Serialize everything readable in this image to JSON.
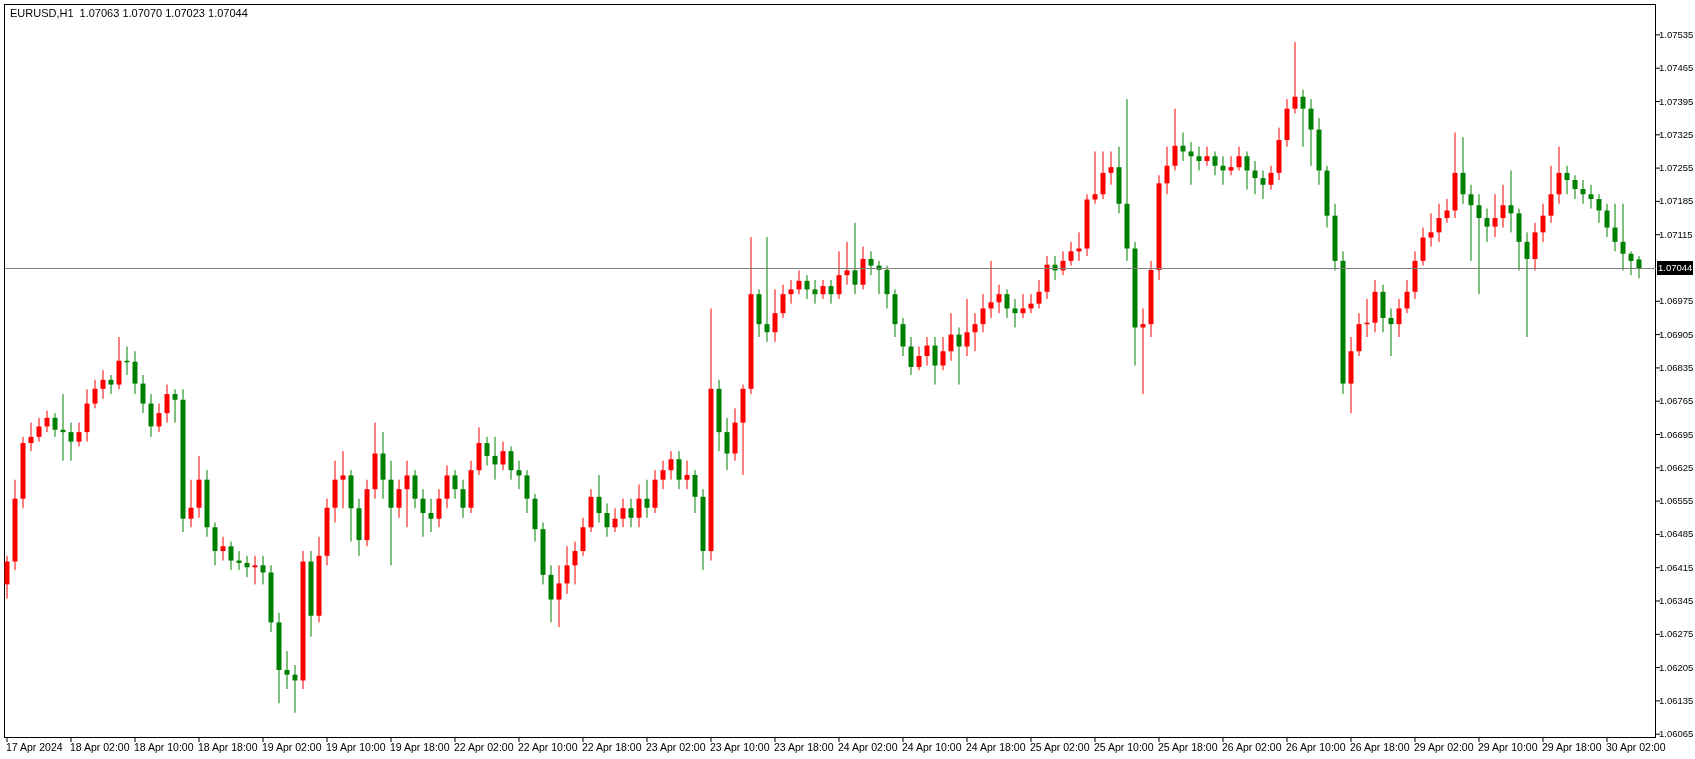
{
  "chart_header": {
    "symbol": "EURUSD,H1",
    "quotes": [
      "1.07063",
      "1.07070",
      "1.07023",
      "1.07044"
    ]
  },
  "price_axis": {
    "current_price": "1.07044"
  },
  "time_axis": {
    "labels": [
      "17 Apr 2024",
      "18 Apr 02:00",
      "18 Apr 10:00",
      "18 Apr 18:00",
      "19 Apr 02:00",
      "19 Apr 10:00",
      "19 Apr 18:00",
      "22 Apr 02:00",
      "22 Apr 10:00",
      "22 Apr 18:00",
      "23 Apr 02:00",
      "23 Apr 10:00",
      "23 Apr 18:00",
      "24 Apr 02:00",
      "24 Apr 10:00",
      "24 Apr 18:00",
      "25 Apr 02:00",
      "25 Apr 10:00",
      "25 Apr 18:00",
      "26 Apr 02:00",
      "26 Apr 10:00",
      "26 Apr 18:00",
      "29 Apr 02:00",
      "29 Apr 10:00",
      "29 Apr 18:00",
      "30 Apr 02:00"
    ]
  },
  "chart": {
    "chart_data": {
      "type": "candlestick",
      "ylim": [
        1.06057,
        1.076
      ],
      "ref_lines": [
        {
          "axis": "y",
          "value": 1.07044
        }
      ],
      "yticks": [
        {
          "value": 1.07535,
          "label": "1.07535"
        },
        {
          "value": 1.07465,
          "label": "1.07465"
        },
        {
          "value": 1.07395,
          "label": "1.07395"
        },
        {
          "value": 1.07325,
          "label": "1.07325"
        },
        {
          "value": 1.07255,
          "label": "1.07255"
        },
        {
          "value": 1.07185,
          "label": "1.07185"
        },
        {
          "value": 1.07115,
          "label": "1.07115"
        },
        {
          "value": 1.06975,
          "label": "1.06975"
        },
        {
          "value": 1.06905,
          "label": "1.06905"
        },
        {
          "value": 1.06835,
          "label": "1.06835"
        },
        {
          "value": 1.06765,
          "label": "1.06765"
        },
        {
          "value": 1.06695,
          "label": "1.06695"
        },
        {
          "value": 1.06625,
          "label": "1.06625"
        },
        {
          "value": 1.06555,
          "label": "1.06555"
        },
        {
          "value": 1.06485,
          "label": "1.06485"
        },
        {
          "value": 1.06415,
          "label": "1.06415"
        },
        {
          "value": 1.06345,
          "label": "1.06345"
        },
        {
          "value": 1.06275,
          "label": "1.06275"
        },
        {
          "value": 1.06205,
          "label": "1.06205"
        },
        {
          "value": 1.06135,
          "label": "1.06135"
        },
        {
          "value": 1.06065,
          "label": "1.06065"
        }
      ],
      "categories": [
        null,
        null,
        null,
        null,
        null,
        null,
        null,
        null,
        null,
        null,
        null,
        null,
        null,
        null,
        null,
        null,
        null,
        null,
        null,
        null,
        null,
        null,
        null,
        null,
        null,
        null,
        null,
        null,
        null,
        null,
        null,
        null,
        null,
        null,
        null,
        null,
        null,
        null,
        null,
        null,
        null,
        null,
        null,
        null,
        null,
        null,
        null,
        null,
        null,
        null,
        null,
        null,
        null,
        null,
        null,
        null,
        null,
        null,
        null,
        null,
        null,
        null,
        null,
        null,
        null,
        null,
        null,
        null,
        null,
        null,
        null,
        null,
        null,
        null,
        null,
        null,
        null,
        null,
        null,
        null,
        null,
        null,
        null,
        null,
        null,
        null,
        null,
        null,
        null,
        null,
        null,
        null,
        null,
        null,
        null,
        null,
        null,
        null,
        null,
        null,
        null,
        null,
        null,
        null,
        null,
        null,
        null,
        null,
        null,
        null,
        null,
        null,
        null,
        null,
        null,
        null,
        null,
        null,
        null,
        null,
        null,
        null,
        null,
        null,
        null,
        null,
        null,
        null,
        null,
        null,
        null,
        null,
        null,
        null,
        null,
        null,
        null,
        null,
        null,
        null,
        null,
        null,
        null,
        null,
        null,
        null,
        null,
        null,
        null,
        null,
        null,
        null,
        null,
        null,
        null,
        null,
        null,
        null,
        null,
        null,
        null,
        null,
        null,
        null,
        null,
        null,
        null,
        null,
        null,
        null,
        null,
        null,
        null,
        null,
        null,
        null,
        null,
        null,
        null,
        null,
        null,
        null,
        null,
        null,
        null,
        null,
        null,
        null,
        null,
        null,
        null,
        null,
        null,
        null,
        null,
        null,
        null,
        null,
        null,
        null,
        null,
        null,
        null,
        null,
        null
      ],
      "ohlc": [
        [
          1.0638,
          1.0644,
          1.0635,
          1.06428
        ],
        [
          1.06428,
          1.066,
          1.0641,
          1.0656
        ],
        [
          1.0656,
          1.0669,
          1.0654,
          1.06677
        ],
        [
          1.06677,
          1.0672,
          1.0666,
          1.0669
        ],
        [
          1.0669,
          1.0673,
          1.0668,
          1.06712
        ],
        [
          1.06712,
          1.06745,
          1.067,
          1.0673
        ],
        [
          1.0673,
          1.0674,
          1.0669,
          1.06705
        ],
        [
          1.06705,
          1.0678,
          1.0664,
          1.067
        ],
        [
          1.067,
          1.0672,
          1.0664,
          1.0668
        ],
        [
          1.0668,
          1.0672,
          1.0667,
          1.067
        ],
        [
          1.067,
          1.0679,
          1.0668,
          1.0676
        ],
        [
          1.0676,
          1.0681,
          1.0675,
          1.06791
        ],
        [
          1.06791,
          1.0683,
          1.0677,
          1.0681
        ],
        [
          1.0681,
          1.0682,
          1.0678,
          1.068
        ],
        [
          1.068,
          1.069,
          1.0679,
          1.0685
        ],
        [
          1.0685,
          1.0688,
          1.0682,
          1.06848
        ],
        [
          1.06848,
          1.0687,
          1.0678,
          1.06802
        ],
        [
          1.06802,
          1.0682,
          1.0674,
          1.0676
        ],
        [
          1.0676,
          1.0678,
          1.0669,
          1.06712
        ],
        [
          1.06712,
          1.0676,
          1.067,
          1.0674
        ],
        [
          1.0674,
          1.068,
          1.0672,
          1.0678
        ],
        [
          1.0678,
          1.0679,
          1.0672,
          1.06768
        ],
        [
          1.06768,
          1.0679,
          1.0649,
          1.06518
        ],
        [
          1.06518,
          1.066,
          1.065,
          1.06541
        ],
        [
          1.06541,
          1.0665,
          1.0652,
          1.066
        ],
        [
          1.066,
          1.0662,
          1.0648,
          1.065
        ],
        [
          1.065,
          1.0651,
          1.0642,
          1.0645
        ],
        [
          1.0645,
          1.0648,
          1.0643,
          1.0646
        ],
        [
          1.0646,
          1.0647,
          1.0641,
          1.0643
        ],
        [
          1.0643,
          1.0645,
          1.0641,
          1.06425
        ],
        [
          1.06425,
          1.0644,
          1.06395,
          1.06416
        ],
        [
          1.06416,
          1.0644,
          1.0638,
          1.0642
        ],
        [
          1.0642,
          1.0644,
          1.0638,
          1.06405
        ],
        [
          1.06405,
          1.0642,
          1.0628,
          1.063
        ],
        [
          1.063,
          1.0632,
          1.0613,
          1.062
        ],
        [
          1.062,
          1.0624,
          1.0616,
          1.0619
        ],
        [
          1.0619,
          1.0621,
          1.0611,
          1.06178
        ],
        [
          1.06178,
          1.0645,
          1.0616,
          1.06428
        ],
        [
          1.06428,
          1.0645,
          1.0627,
          1.06314
        ],
        [
          1.06314,
          1.0648,
          1.063,
          1.0644
        ],
        [
          1.0644,
          1.0656,
          1.0642,
          1.06541
        ],
        [
          1.06541,
          1.0664,
          1.0651,
          1.066
        ],
        [
          1.066,
          1.0666,
          1.0654,
          1.06609
        ],
        [
          1.06609,
          1.0662,
          1.0647,
          1.0654
        ],
        [
          1.0654,
          1.0656,
          1.0644,
          1.06473
        ],
        [
          1.06473,
          1.066,
          1.0646,
          1.0658
        ],
        [
          1.0658,
          1.0672,
          1.0656,
          1.06655
        ],
        [
          1.06655,
          1.067,
          1.0656,
          1.066
        ],
        [
          1.066,
          1.0664,
          1.0642,
          1.06541
        ],
        [
          1.06541,
          1.066,
          1.0652,
          1.0658
        ],
        [
          1.0658,
          1.0664,
          1.065,
          1.06609
        ],
        [
          1.06609,
          1.0662,
          1.0654,
          1.0656
        ],
        [
          1.0656,
          1.0658,
          1.0648,
          1.0653
        ],
        [
          1.0653,
          1.0656,
          1.0649,
          1.06518
        ],
        [
          1.06518,
          1.0658,
          1.065,
          1.0656
        ],
        [
          1.0656,
          1.0663,
          1.0654,
          1.06609
        ],
        [
          1.06609,
          1.0662,
          1.0656,
          1.0658
        ],
        [
          1.0658,
          1.066,
          1.0652,
          1.06541
        ],
        [
          1.06541,
          1.0664,
          1.0653,
          1.0662
        ],
        [
          1.0662,
          1.0671,
          1.0661,
          1.06677
        ],
        [
          1.06677,
          1.0669,
          1.0663,
          1.0665
        ],
        [
          1.0665,
          1.0669,
          1.066,
          1.06632
        ],
        [
          1.06632,
          1.0668,
          1.0662,
          1.0666
        ],
        [
          1.0666,
          1.0667,
          1.066,
          1.0662
        ],
        [
          1.0662,
          1.0664,
          1.0658,
          1.06609
        ],
        [
          1.06609,
          1.0662,
          1.0653,
          1.0656
        ],
        [
          1.0656,
          1.0657,
          1.0647,
          1.06496
        ],
        [
          1.06496,
          1.0651,
          1.0638,
          1.064
        ],
        [
          1.064,
          1.0642,
          1.063,
          1.06348
        ],
        [
          1.06348,
          1.0642,
          1.0629,
          1.06382
        ],
        [
          1.06382,
          1.0646,
          1.0636,
          1.0642
        ],
        [
          1.0642,
          1.0647,
          1.0638,
          1.0645
        ],
        [
          1.0645,
          1.0652,
          1.0644,
          1.065
        ],
        [
          1.065,
          1.0658,
          1.0649,
          1.06564
        ],
        [
          1.06564,
          1.0661,
          1.0651,
          1.0653
        ],
        [
          1.0653,
          1.0655,
          1.0648,
          1.065
        ],
        [
          1.065,
          1.0654,
          1.0649,
          1.06518
        ],
        [
          1.06518,
          1.0656,
          1.065,
          1.0654
        ],
        [
          1.0654,
          1.0656,
          1.065,
          1.0652
        ],
        [
          1.0652,
          1.0659,
          1.065,
          1.0656
        ],
        [
          1.0656,
          1.066,
          1.0652,
          1.06541
        ],
        [
          1.06541,
          1.0662,
          1.0653,
          1.066
        ],
        [
          1.066,
          1.0664,
          1.0658,
          1.0662
        ],
        [
          1.0662,
          1.0666,
          1.066,
          1.06643
        ],
        [
          1.06643,
          1.0666,
          1.0658,
          1.066
        ],
        [
          1.066,
          1.0664,
          1.0658,
          1.0661
        ],
        [
          1.0661,
          1.0662,
          1.0653,
          1.06564
        ],
        [
          1.06564,
          1.0658,
          1.0641,
          1.0645
        ],
        [
          1.0645,
          1.0696,
          1.0643,
          1.06791
        ],
        [
          1.06791,
          1.0681,
          1.0666,
          1.067
        ],
        [
          1.067,
          1.0673,
          1.0662,
          1.06655
        ],
        [
          1.06655,
          1.0675,
          1.0664,
          1.0672
        ],
        [
          1.0672,
          1.068,
          1.0661,
          1.06791
        ],
        [
          1.06791,
          1.0711,
          1.0678,
          1.0699
        ],
        [
          1.0699,
          1.07,
          1.069,
          1.06927
        ],
        [
          1.06927,
          1.0711,
          1.0689,
          1.0691
        ],
        [
          1.0691,
          1.07,
          1.0689,
          1.0695
        ],
        [
          1.0695,
          1.0701,
          1.0694,
          1.0699
        ],
        [
          1.0699,
          1.0702,
          1.0697,
          1.07
        ],
        [
          1.07,
          1.0704,
          1.0699,
          1.07018
        ],
        [
          1.07018,
          1.0703,
          1.0698,
          1.07
        ],
        [
          1.07,
          1.0702,
          1.0697,
          1.0699
        ],
        [
          1.0699,
          1.0702,
          1.0698,
          1.07007
        ],
        [
          1.07007,
          1.0702,
          1.0697,
          1.0699
        ],
        [
          1.0699,
          1.0708,
          1.0698,
          1.0703
        ],
        [
          1.0703,
          1.071,
          1.0701,
          1.0704
        ],
        [
          1.0704,
          1.0714,
          1.0699,
          1.0701
        ],
        [
          1.0701,
          1.0709,
          1.07,
          1.07064
        ],
        [
          1.07064,
          1.0708,
          1.0703,
          1.0705
        ],
        [
          1.0705,
          1.0706,
          1.0699,
          1.07041
        ],
        [
          1.07041,
          1.0705,
          1.0696,
          1.0699
        ],
        [
          1.0699,
          1.07,
          1.069,
          1.06927
        ],
        [
          1.06927,
          1.0694,
          1.0686,
          1.0688
        ],
        [
          1.0688,
          1.069,
          1.0682,
          1.06837
        ],
        [
          1.06837,
          1.0688,
          1.0683,
          1.0686
        ],
        [
          1.0686,
          1.069,
          1.0684,
          1.06882
        ],
        [
          1.06882,
          1.069,
          1.068,
          1.0684
        ],
        [
          1.0684,
          1.069,
          1.0683,
          1.0687
        ],
        [
          1.0687,
          1.0695,
          1.0685,
          1.06905
        ],
        [
          1.06905,
          1.0692,
          1.068,
          1.0688
        ],
        [
          1.0688,
          1.0698,
          1.0686,
          1.0691
        ],
        [
          1.0691,
          1.0695,
          1.0687,
          1.06927
        ],
        [
          1.06927,
          1.0699,
          1.0691,
          1.0696
        ],
        [
          1.0696,
          1.0706,
          1.0694,
          1.06973
        ],
        [
          1.06973,
          1.0701,
          1.0695,
          1.0699
        ],
        [
          1.0699,
          1.07,
          1.0694,
          1.0696
        ],
        [
          1.0696,
          1.0698,
          1.0692,
          1.0695
        ],
        [
          1.0695,
          1.0699,
          1.0694,
          1.0696
        ],
        [
          1.0696,
          1.0699,
          1.0695,
          1.0697
        ],
        [
          1.0697,
          1.0702,
          1.0696,
          1.06995
        ],
        [
          1.06995,
          1.0707,
          1.0698,
          1.07052
        ],
        [
          1.07052,
          1.0707,
          1.0702,
          1.0704
        ],
        [
          1.0704,
          1.0708,
          1.0703,
          1.0706
        ],
        [
          1.0706,
          1.071,
          1.0705,
          1.0708
        ],
        [
          1.0708,
          1.0712,
          1.0706,
          1.07086
        ],
        [
          1.07086,
          1.072,
          1.0707,
          1.07189
        ],
        [
          1.07189,
          1.0729,
          1.0718,
          1.072
        ],
        [
          1.072,
          1.0729,
          1.0719,
          1.07245
        ],
        [
          1.07245,
          1.0729,
          1.0722,
          1.07257
        ],
        [
          1.07257,
          1.073,
          1.0716,
          1.0718
        ],
        [
          1.0718,
          1.074,
          1.0706,
          1.07086
        ],
        [
          1.07086,
          1.071,
          1.0684,
          1.0692
        ],
        [
          1.0692,
          1.0696,
          1.0678,
          1.06927
        ],
        [
          1.06927,
          1.0706,
          1.069,
          1.07041
        ],
        [
          1.07041,
          1.0724,
          1.0702,
          1.07223
        ],
        [
          1.07223,
          1.073,
          1.072,
          1.0726
        ],
        [
          1.0726,
          1.0738,
          1.0725,
          1.07302
        ],
        [
          1.07302,
          1.0733,
          1.0727,
          1.0729
        ],
        [
          1.0729,
          1.0731,
          1.0722,
          1.0728
        ],
        [
          1.0728,
          1.073,
          1.0725,
          1.0727
        ],
        [
          1.0727,
          1.073,
          1.0726,
          1.0728
        ],
        [
          1.0728,
          1.0729,
          1.0724,
          1.0726
        ],
        [
          1.0726,
          1.0728,
          1.0722,
          1.0725
        ],
        [
          1.0725,
          1.0728,
          1.0724,
          1.07257
        ],
        [
          1.07257,
          1.073,
          1.0725,
          1.0728
        ],
        [
          1.0728,
          1.0729,
          1.0721,
          1.0725
        ],
        [
          1.0725,
          1.0727,
          1.072,
          1.07234
        ],
        [
          1.07234,
          1.0725,
          1.0719,
          1.0722
        ],
        [
          1.0722,
          1.0726,
          1.0721,
          1.07245
        ],
        [
          1.07245,
          1.0734,
          1.0723,
          1.07314
        ],
        [
          1.07314,
          1.074,
          1.073,
          1.0738
        ],
        [
          1.0738,
          1.0752,
          1.0737,
          1.07405
        ],
        [
          1.07405,
          1.0742,
          1.073,
          1.0738
        ],
        [
          1.0738,
          1.074,
          1.0726,
          1.07336
        ],
        [
          1.07336,
          1.0736,
          1.0722,
          1.0725
        ],
        [
          1.0725,
          1.0726,
          1.0713,
          1.07155
        ],
        [
          1.07155,
          1.0718,
          1.0704,
          1.0706
        ],
        [
          1.0706,
          1.0708,
          1.0678,
          1.06802
        ],
        [
          1.06802,
          1.069,
          1.0674,
          1.0687
        ],
        [
          1.0687,
          1.0695,
          1.0686,
          1.06927
        ],
        [
          1.06927,
          1.0698,
          1.069,
          1.0693
        ],
        [
          1.0693,
          1.0702,
          1.0691,
          1.06995
        ],
        [
          1.06995,
          1.0701,
          1.0691,
          1.0694
        ],
        [
          1.0694,
          1.0696,
          1.0686,
          1.06927
        ],
        [
          1.06927,
          1.0698,
          1.069,
          1.0696
        ],
        [
          1.0696,
          1.0702,
          1.0695,
          1.06995
        ],
        [
          1.06995,
          1.0708,
          1.0698,
          1.0706
        ],
        [
          1.0706,
          1.0713,
          1.0705,
          1.07109
        ],
        [
          1.07109,
          1.0716,
          1.0709,
          1.0712
        ],
        [
          1.0712,
          1.0718,
          1.071,
          1.0715
        ],
        [
          1.0715,
          1.0719,
          1.0714,
          1.07166
        ],
        [
          1.07166,
          1.0733,
          1.0715,
          1.07245
        ],
        [
          1.07245,
          1.0732,
          1.0718,
          1.072
        ],
        [
          1.072,
          1.0722,
          1.0706,
          1.07177
        ],
        [
          1.07177,
          1.072,
          1.0699,
          1.0715
        ],
        [
          1.0715,
          1.0717,
          1.071,
          1.07132
        ],
        [
          1.07132,
          1.072,
          1.0711,
          1.0715
        ],
        [
          1.0715,
          1.0722,
          1.0713,
          1.07177
        ],
        [
          1.07177,
          1.0725,
          1.0712,
          1.0716
        ],
        [
          1.0716,
          1.0717,
          1.0704,
          1.071
        ],
        [
          1.071,
          1.0712,
          1.069,
          1.07064
        ],
        [
          1.07064,
          1.0714,
          1.0704,
          1.0712
        ],
        [
          1.0712,
          1.0718,
          1.071,
          1.07155
        ],
        [
          1.07155,
          1.0726,
          1.0714,
          1.072
        ],
        [
          1.072,
          1.073,
          1.0718,
          1.07245
        ],
        [
          1.07245,
          1.0726,
          1.072,
          1.0723
        ],
        [
          1.0723,
          1.0724,
          1.0719,
          1.07211
        ],
        [
          1.07211,
          1.0723,
          1.0718,
          1.072
        ],
        [
          1.072,
          1.0722,
          1.0717,
          1.0719
        ],
        [
          1.0719,
          1.072,
          1.0714,
          1.07166
        ],
        [
          1.07166,
          1.0718,
          1.0711,
          1.0713
        ],
        [
          1.0713,
          1.0718,
          1.0708,
          1.071
        ],
        [
          1.071,
          1.0718,
          1.0704,
          1.07075
        ],
        [
          1.07075,
          1.0708,
          1.0703,
          1.0706
        ],
        [
          1.07063,
          1.0707,
          1.07023,
          1.07044
        ]
      ]
    }
  }
}
